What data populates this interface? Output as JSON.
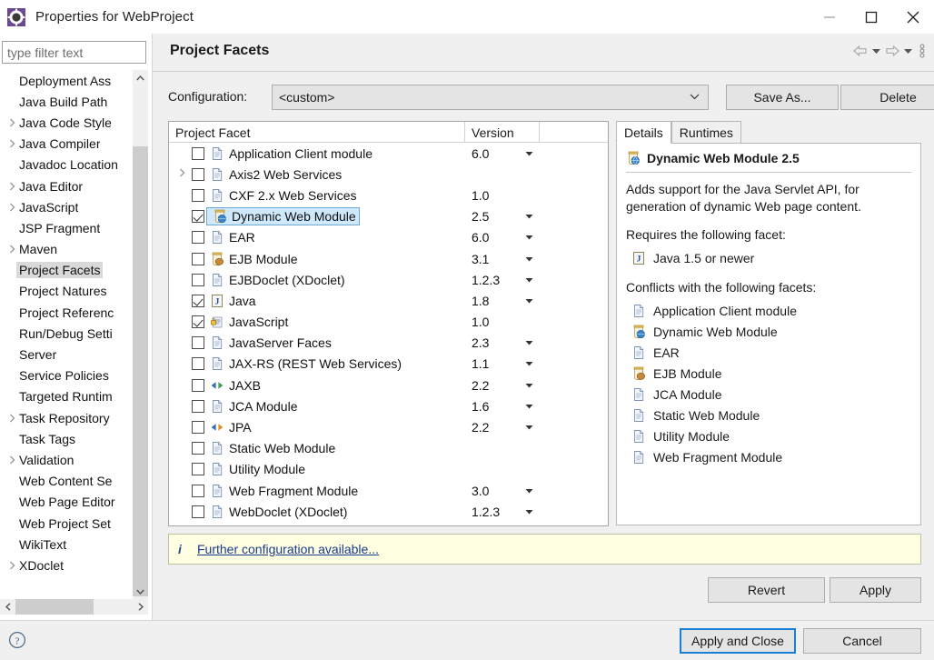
{
  "window": {
    "title": "Properties for WebProject",
    "icon": "eclipse-gear-icon",
    "minimize_label": "—",
    "maximize_label": "□",
    "close_label": "✕"
  },
  "sidebar": {
    "filter_placeholder": "type filter text",
    "filter_value": "",
    "items": [
      {
        "label": "Deployment Ass",
        "expandable": false,
        "selected": false
      },
      {
        "label": "Java Build Path",
        "expandable": false,
        "selected": false
      },
      {
        "label": "Java Code Style",
        "expandable": true,
        "selected": false
      },
      {
        "label": "Java Compiler",
        "expandable": true,
        "selected": false
      },
      {
        "label": "Javadoc Location",
        "expandable": false,
        "selected": false
      },
      {
        "label": "Java Editor",
        "expandable": true,
        "selected": false
      },
      {
        "label": "JavaScript",
        "expandable": true,
        "selected": false
      },
      {
        "label": "JSP Fragment",
        "expandable": false,
        "selected": false
      },
      {
        "label": "Maven",
        "expandable": true,
        "selected": false
      },
      {
        "label": "Project Facets",
        "expandable": false,
        "selected": true
      },
      {
        "label": "Project Natures",
        "expandable": false,
        "selected": false
      },
      {
        "label": "Project Referenc",
        "expandable": false,
        "selected": false
      },
      {
        "label": "Run/Debug Setti",
        "expandable": false,
        "selected": false
      },
      {
        "label": "Server",
        "expandable": false,
        "selected": false
      },
      {
        "label": "Service Policies",
        "expandable": false,
        "selected": false
      },
      {
        "label": "Targeted Runtim",
        "expandable": false,
        "selected": false
      },
      {
        "label": "Task Repository",
        "expandable": true,
        "selected": false
      },
      {
        "label": "Task Tags",
        "expandable": false,
        "selected": false
      },
      {
        "label": "Validation",
        "expandable": true,
        "selected": false
      },
      {
        "label": "Web Content Se",
        "expandable": false,
        "selected": false
      },
      {
        "label": "Web Page Editor",
        "expandable": false,
        "selected": false
      },
      {
        "label": "Web Project Set",
        "expandable": false,
        "selected": false
      },
      {
        "label": "WikiText",
        "expandable": false,
        "selected": false
      },
      {
        "label": "XDoclet",
        "expandable": true,
        "selected": false
      }
    ]
  },
  "page": {
    "title": "Project Facets",
    "nav": {
      "back_icon": "back-arrow-icon",
      "back_menu_icon": "chevron-down-icon",
      "forward_icon": "forward-arrow-icon",
      "forward_menu_icon": "chevron-down-icon",
      "overflow_icon": "vertical-dots-icon"
    }
  },
  "configuration": {
    "label": "Configuration:",
    "value": "<custom>",
    "save_as_label": "Save As...",
    "delete_label": "Delete"
  },
  "facet_table": {
    "columns": [
      "Project Facet",
      "Version",
      ""
    ],
    "rows": [
      {
        "name": "Application Client module",
        "version": "6.0",
        "checked": false,
        "expandable": false,
        "selected": false,
        "icon": "document-icon",
        "has_version_menu": true
      },
      {
        "name": "Axis2 Web Services",
        "version": "",
        "checked": false,
        "expandable": true,
        "selected": false,
        "icon": "document-icon",
        "has_version_menu": false
      },
      {
        "name": "CXF 2.x Web Services",
        "version": "1.0",
        "checked": false,
        "expandable": false,
        "selected": false,
        "icon": "document-icon",
        "has_version_menu": false
      },
      {
        "name": "Dynamic Web Module",
        "version": "2.5",
        "checked": true,
        "expandable": false,
        "selected": true,
        "icon": "web-module-icon",
        "has_version_menu": true
      },
      {
        "name": "EAR",
        "version": "6.0",
        "checked": false,
        "expandable": false,
        "selected": false,
        "icon": "document-icon",
        "has_version_menu": true
      },
      {
        "name": "EJB Module",
        "version": "3.1",
        "checked": false,
        "expandable": false,
        "selected": false,
        "icon": "ejb-module-icon",
        "has_version_menu": true
      },
      {
        "name": "EJBDoclet (XDoclet)",
        "version": "1.2.3",
        "checked": false,
        "expandable": false,
        "selected": false,
        "icon": "document-icon",
        "has_version_menu": true
      },
      {
        "name": "Java",
        "version": "1.8",
        "checked": true,
        "expandable": false,
        "selected": false,
        "icon": "java-icon",
        "has_version_menu": true
      },
      {
        "name": "JavaScript",
        "version": "1.0",
        "checked": true,
        "expandable": false,
        "selected": false,
        "icon": "javascript-icon",
        "has_version_menu": false
      },
      {
        "name": "JavaServer Faces",
        "version": "2.3",
        "checked": false,
        "expandable": false,
        "selected": false,
        "icon": "document-icon",
        "has_version_menu": true
      },
      {
        "name": "JAX-RS (REST Web Services)",
        "version": "1.1",
        "checked": false,
        "expandable": false,
        "selected": false,
        "icon": "document-icon",
        "has_version_menu": true
      },
      {
        "name": "JAXB",
        "version": "2.2",
        "checked": false,
        "expandable": false,
        "selected": false,
        "icon": "jaxb-arrows-icon",
        "has_version_menu": true
      },
      {
        "name": "JCA Module",
        "version": "1.6",
        "checked": false,
        "expandable": false,
        "selected": false,
        "icon": "document-icon",
        "has_version_menu": true
      },
      {
        "name": "JPA",
        "version": "2.2",
        "checked": false,
        "expandable": false,
        "selected": false,
        "icon": "jpa-arrows-icon",
        "has_version_menu": true
      },
      {
        "name": "Static Web Module",
        "version": "",
        "checked": false,
        "expandable": false,
        "selected": false,
        "icon": "document-icon",
        "has_version_menu": false
      },
      {
        "name": "Utility Module",
        "version": "",
        "checked": false,
        "expandable": false,
        "selected": false,
        "icon": "document-icon",
        "has_version_menu": false
      },
      {
        "name": "Web Fragment Module",
        "version": "3.0",
        "checked": false,
        "expandable": false,
        "selected": false,
        "icon": "document-icon",
        "has_version_menu": true
      },
      {
        "name": "WebDoclet (XDoclet)",
        "version": "1.2.3",
        "checked": false,
        "expandable": false,
        "selected": false,
        "icon": "document-icon",
        "has_version_menu": true
      }
    ]
  },
  "details": {
    "tabs": [
      {
        "label": "Details",
        "active": true
      },
      {
        "label": "Runtimes",
        "active": false
      }
    ],
    "facet_title": "Dynamic Web Module 2.5",
    "facet_icon": "web-module-icon",
    "description": "Adds support for the Java Servlet API, for generation of dynamic Web page content.",
    "requires_heading": "Requires the following facet:",
    "requires": [
      {
        "label": "Java 1.5 or newer",
        "icon": "java-icon"
      }
    ],
    "conflicts_heading": "Conflicts with the following facets:",
    "conflicts": [
      {
        "label": "Application Client module",
        "icon": "document-icon"
      },
      {
        "label": "Dynamic Web Module",
        "icon": "web-module-icon"
      },
      {
        "label": "EAR",
        "icon": "document-icon"
      },
      {
        "label": "EJB Module",
        "icon": "ejb-module-icon"
      },
      {
        "label": "JCA Module",
        "icon": "document-icon"
      },
      {
        "label": "Static Web Module",
        "icon": "document-icon"
      },
      {
        "label": "Utility Module",
        "icon": "document-icon"
      },
      {
        "label": "Web Fragment Module",
        "icon": "document-icon"
      }
    ]
  },
  "info_bar": {
    "icon": "info-icon",
    "link_text": "Further configuration available...",
    "background_color": "#ffffe1"
  },
  "buttons": {
    "revert": "Revert",
    "apply": "Apply",
    "apply_and_close": "Apply and Close",
    "cancel": "Cancel",
    "help_icon": "help-question-icon",
    "default_button_accent": "#1a7fd4"
  }
}
